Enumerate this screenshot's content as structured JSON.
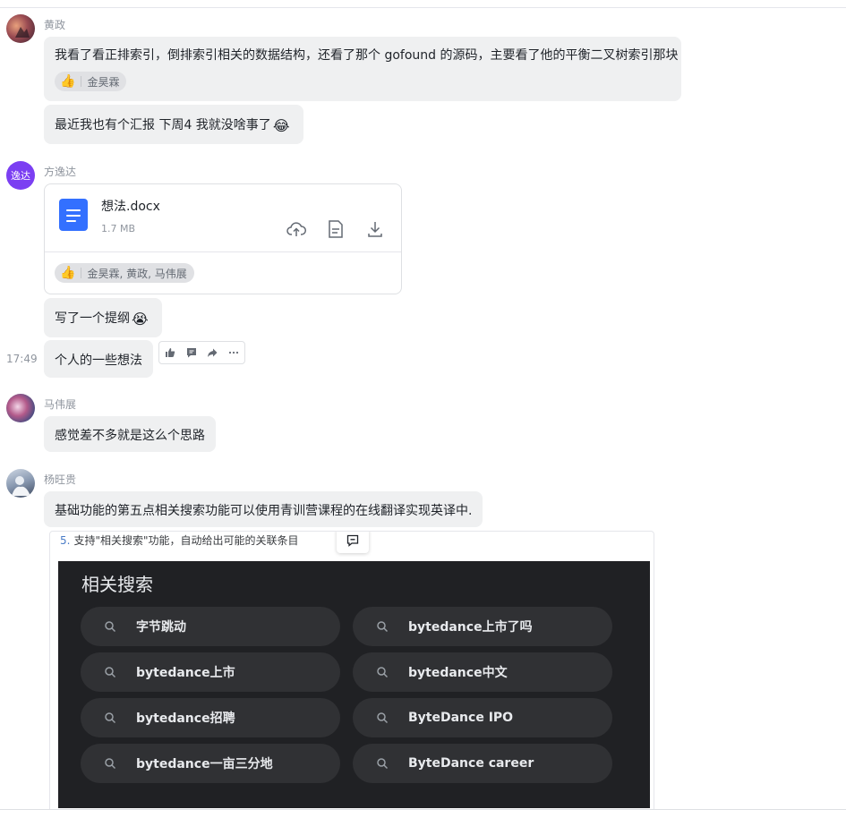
{
  "messages": {
    "m1": {
      "sender": "黄政",
      "text1": "我看了看正排索引，倒排索引相关的数据结构，还看了那个 gofound 的源码，主要看了他的平衡二叉树索引那块",
      "reaction_users": "金昊霖",
      "text2": "最近我也有个汇报 下周4 我就没啥事了",
      "text2_emoji": "😂"
    },
    "m2": {
      "sender": "方逸达",
      "avatar_text": "逸达",
      "file_name": "想法.docx",
      "file_size": "1.7 MB",
      "file_reaction_users": "金昊霖, 黄政, 马伟展",
      "text1": "写了一个提纲",
      "text1_emoji": "😭",
      "time": "17:49",
      "text2": "个人的一些想法"
    },
    "m3": {
      "sender": "马伟展",
      "text": "感觉差不多就是这么个思路"
    },
    "m4": {
      "sender": "杨旺贵",
      "text": "基础功能的第五点相关搜索功能可以使用青训营课程的在线翻译实现英译中.",
      "image": {
        "caption_num": "5.",
        "caption": "支持\"相关搜索\"功能，自动给出可能的关联条目",
        "title": "相关搜索",
        "items": [
          "字节跳动",
          "bytedance上市了吗",
          "bytedance上市",
          "bytedance中文",
          "bytedance招聘",
          "ByteDance IPO",
          "bytedance一亩三分地",
          "ByteDance career"
        ]
      }
    }
  },
  "icons": {
    "reaction": "thumbs-up-icon",
    "file": "doc-file-icon",
    "cloud": "cloud-upload-icon",
    "preview": "document-preview-icon",
    "download": "download-icon",
    "toolbar": [
      "thumbs-up-icon",
      "comment-icon",
      "forward-icon",
      "more-icon"
    ]
  },
  "colors": {
    "bubble": "#eff0f1",
    "file_blue": "#3370ff",
    "avatar_purple": "#7b3ff2"
  }
}
